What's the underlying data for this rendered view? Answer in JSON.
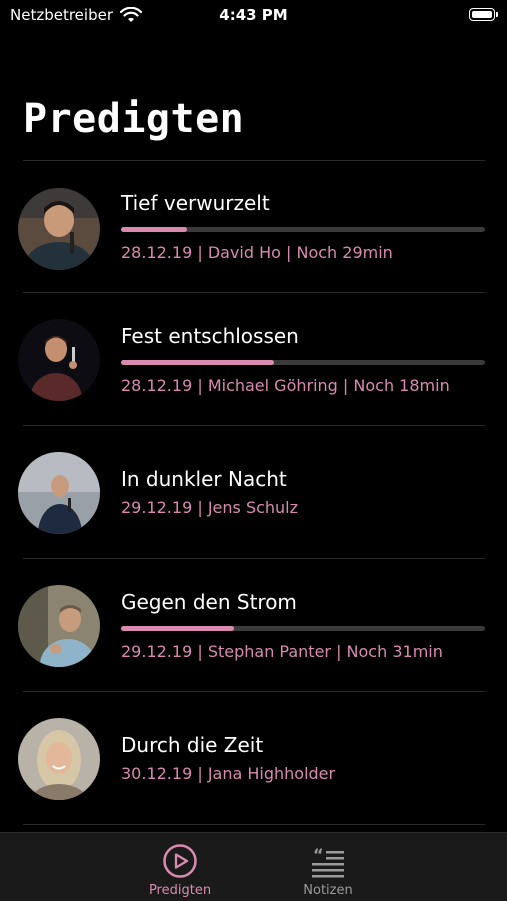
{
  "status_bar": {
    "carrier": "Netzbetreiber",
    "time": "4:43 PM"
  },
  "header": {
    "title": "Predigten"
  },
  "sermons": [
    {
      "title": "Tief verwurzelt",
      "meta": "28.12.19 | David Ho | Noch 29min",
      "progress": 0.18,
      "avatar_icon": "speaker-photo"
    },
    {
      "title": "Fest entschlossen",
      "meta": "28.12.19 | Michael Göhring | Noch 18min",
      "progress": 0.42,
      "avatar_icon": "speaker-photo"
    },
    {
      "title": "In dunkler Nacht",
      "meta": "29.12.19 | Jens Schulz",
      "progress": null,
      "avatar_icon": "speaker-photo"
    },
    {
      "title": "Gegen den Strom",
      "meta": "29.12.19 | Stephan Panter | Noch 31min",
      "progress": 0.31,
      "avatar_icon": "speaker-photo"
    },
    {
      "title": "Durch die Zeit",
      "meta": "30.12.19 | Jana Highholder",
      "progress": null,
      "avatar_icon": "speaker-photo"
    }
  ],
  "tab_bar": {
    "tabs": [
      {
        "label": "Predigten",
        "icon": "play-circle-icon",
        "active": true
      },
      {
        "label": "Notizen",
        "icon": "quote-notes-icon",
        "active": false
      }
    ]
  },
  "colors": {
    "accent": "#d98ab0",
    "background": "#000000",
    "track": "#3a3a3a",
    "tab_bar": "#1a1a1a"
  }
}
